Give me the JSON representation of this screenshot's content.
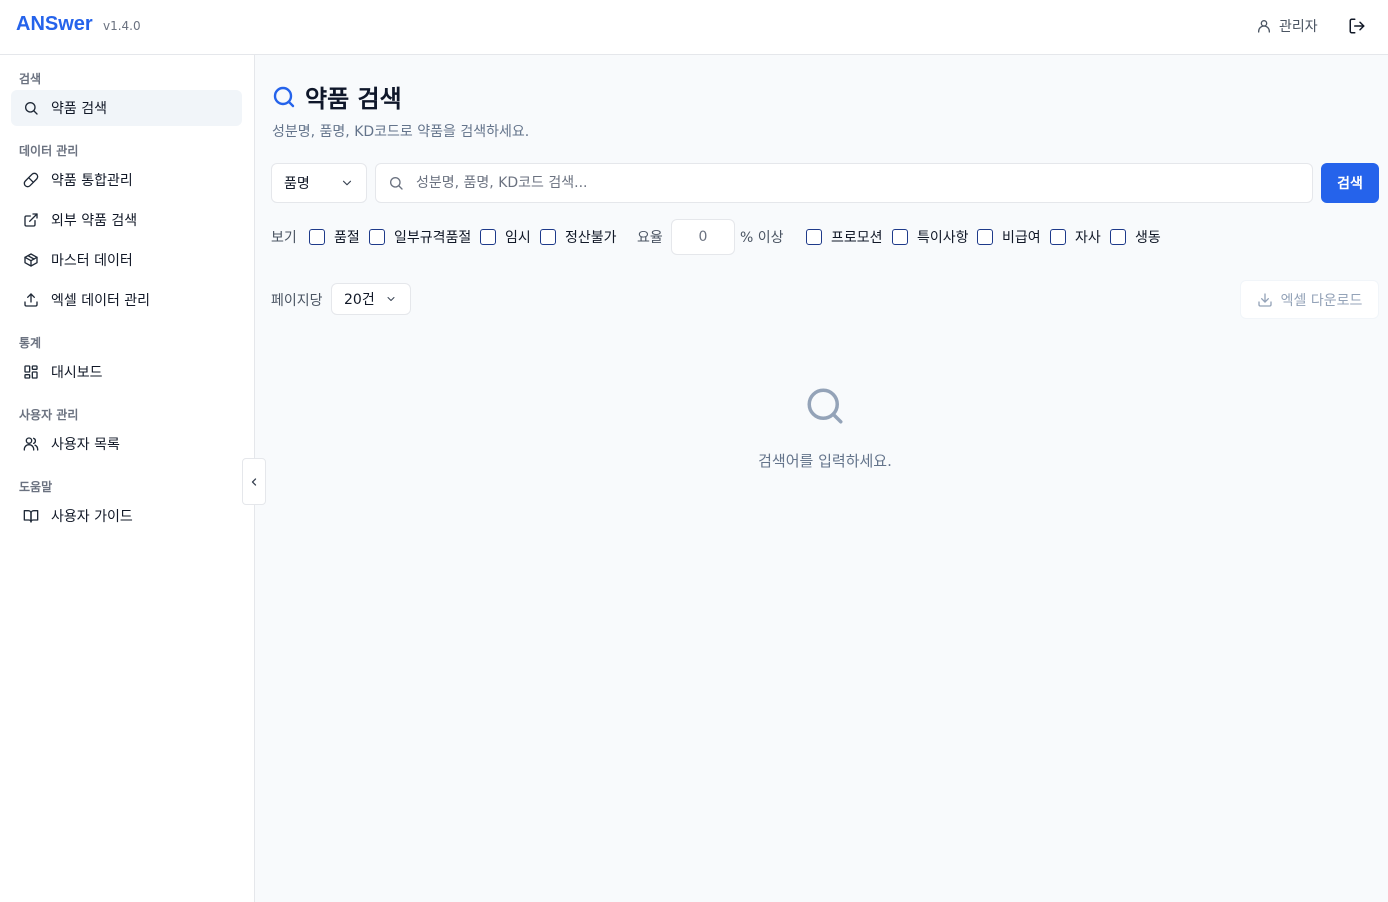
{
  "header": {
    "brand": "ANSwer",
    "version": "v1.4.0",
    "user_label": "관리자"
  },
  "sidebar": {
    "sections": [
      {
        "title": "검색",
        "items": [
          {
            "label": "약품 검색",
            "icon": "search-icon",
            "active": true
          }
        ]
      },
      {
        "title": "데이터 관리",
        "items": [
          {
            "label": "약품 통합관리",
            "icon": "pill-icon"
          },
          {
            "label": "외부 약품 검색",
            "icon": "external-link-icon"
          },
          {
            "label": "마스터 데이터",
            "icon": "package-icon"
          },
          {
            "label": "엑셀 데이터 관리",
            "icon": "upload-icon"
          }
        ]
      },
      {
        "title": "통계",
        "items": [
          {
            "label": "대시보드",
            "icon": "dashboard-grid-icon"
          }
        ]
      },
      {
        "title": "사용자 관리",
        "items": [
          {
            "label": "사용자 목록",
            "icon": "users-icon"
          }
        ]
      },
      {
        "title": "도움말",
        "items": [
          {
            "label": "사용자 가이드",
            "icon": "book-open-icon"
          }
        ]
      }
    ]
  },
  "main": {
    "title": "약품 검색",
    "subtitle": "성분명, 품명, KD코드로 약품을 검색하세요.",
    "search": {
      "type_selected": "품명",
      "placeholder": "성분명, 품명, KD코드 검색...",
      "value": "",
      "button_label": "검색"
    },
    "filters": {
      "view_label": "보기",
      "checkboxes_a": [
        "품절",
        "일부규격품절",
        "임시",
        "정산불가"
      ],
      "rate_label": "요율",
      "rate_value": "0",
      "rate_suffix": "% 이상",
      "checkboxes_b": [
        "프로모션",
        "특이사항",
        "비급여",
        "자사",
        "생동"
      ]
    },
    "per_page_label": "페이지당",
    "per_page_value": "20건",
    "excel_button_label": "엑셀 다운로드",
    "empty_message": "검색어를 입력하세요."
  },
  "colors": {
    "accent": "#2563eb",
    "sidebar_active_bg": "#f1f5f9",
    "border": "#e5e7eb",
    "muted_text": "#64748b"
  }
}
